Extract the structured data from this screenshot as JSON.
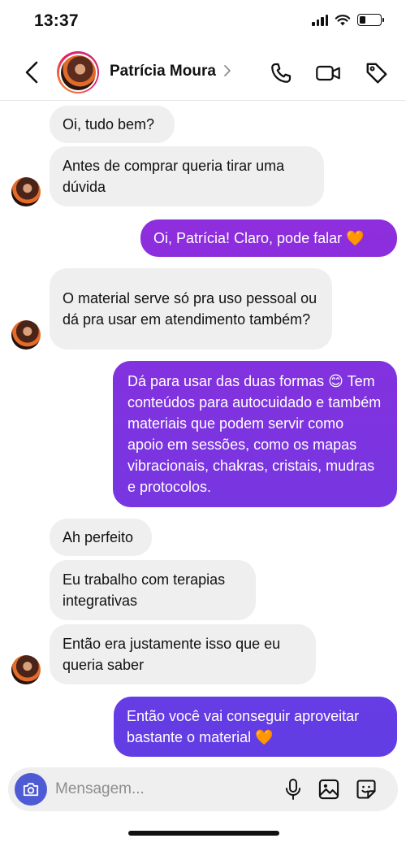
{
  "status_bar": {
    "time": "13:37",
    "battery_level": 0.3
  },
  "header": {
    "contact_name": "Patrícia Moura",
    "icons": [
      "back-icon",
      "chevron-right-icon",
      "phone-icon",
      "video-camera-icon",
      "tag-icon"
    ]
  },
  "messages": [
    {
      "dir": "in",
      "text": "Oi, tudo bem?"
    },
    {
      "dir": "in",
      "text": " Antes de comprar queria tirar uma dúvida"
    },
    {
      "dir": "out",
      "text": "Oi, Patrícia! Claro, pode falar 🧡"
    },
    {
      "dir": "in",
      "text": "O material serve só pra uso pessoal ou dá pra usar em atendimento também?"
    },
    {
      "dir": "out",
      "text": "Dá para usar das duas formas 😊 Tem conteúdos para autocuidado e também materiais que podem servir como apoio em sessões, como os mapas vibracionais, chakras, cristais, mudras e protocolos."
    },
    {
      "dir": "in",
      "text": "Ah perfeito"
    },
    {
      "dir": "in",
      "text": "Eu trabalho com terapias integrativas"
    },
    {
      "dir": "in",
      "text": "Então era justamente isso que eu queria saber"
    },
    {
      "dir": "out",
      "text": "Então você vai conseguir aproveitar bastante o material 🧡"
    }
  ],
  "composer": {
    "placeholder": "Mensagem...",
    "icons": [
      "camera-icon",
      "microphone-icon",
      "image-icon",
      "sticker-icon"
    ]
  },
  "colors": {
    "incoming_bubble": "#efefef",
    "outgoing_top": "#a127d9",
    "outgoing_bottom": "#5a40e6",
    "camera_button": "#4f5bd5"
  }
}
